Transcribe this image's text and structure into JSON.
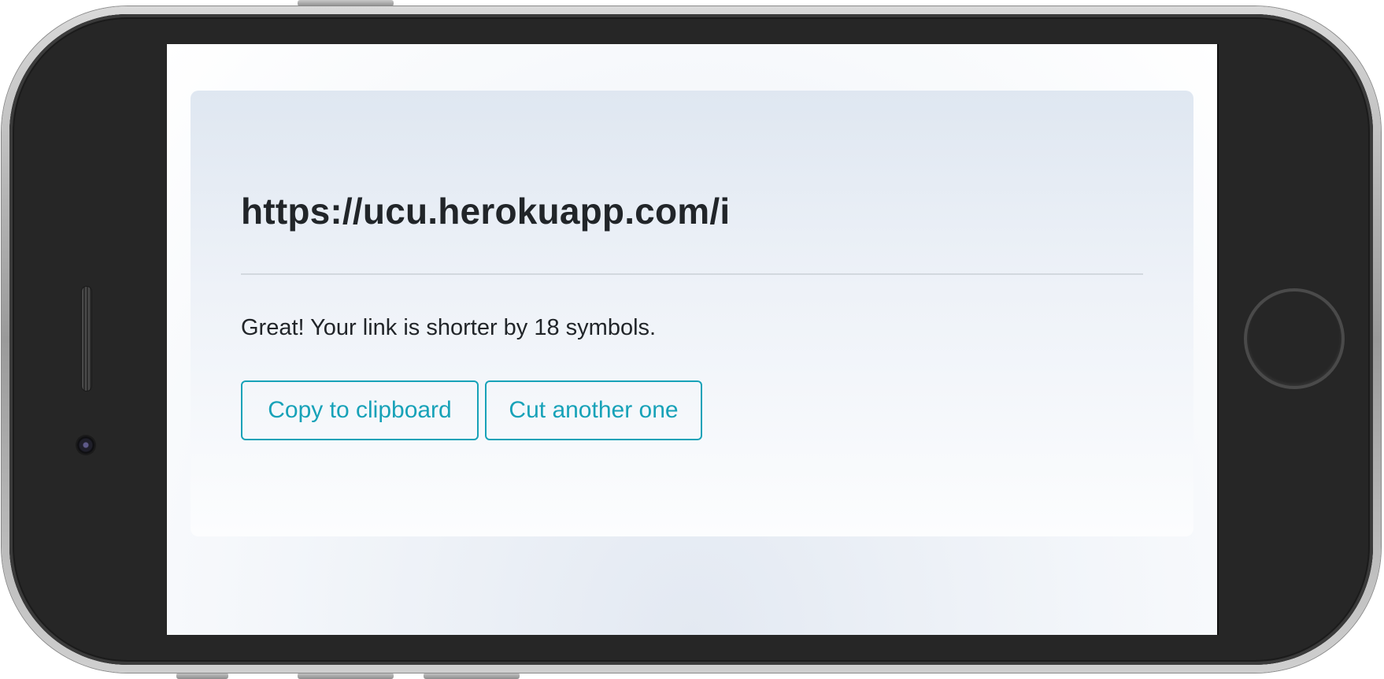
{
  "result": {
    "short_url": "https://ucu.herokuapp.com/i",
    "message": "Great! Your link is shorter by 18 symbols."
  },
  "actions": {
    "copy_label": "Copy to clipboard",
    "cut_label": "Cut another one"
  },
  "colors": {
    "accent": "#17a2b8",
    "text": "#212529",
    "card_top": "#dfe7f1",
    "phone_body": "#262626"
  },
  "device": {
    "icons": [
      "speaker-grille-icon",
      "front-camera-icon",
      "home-button-icon"
    ]
  }
}
